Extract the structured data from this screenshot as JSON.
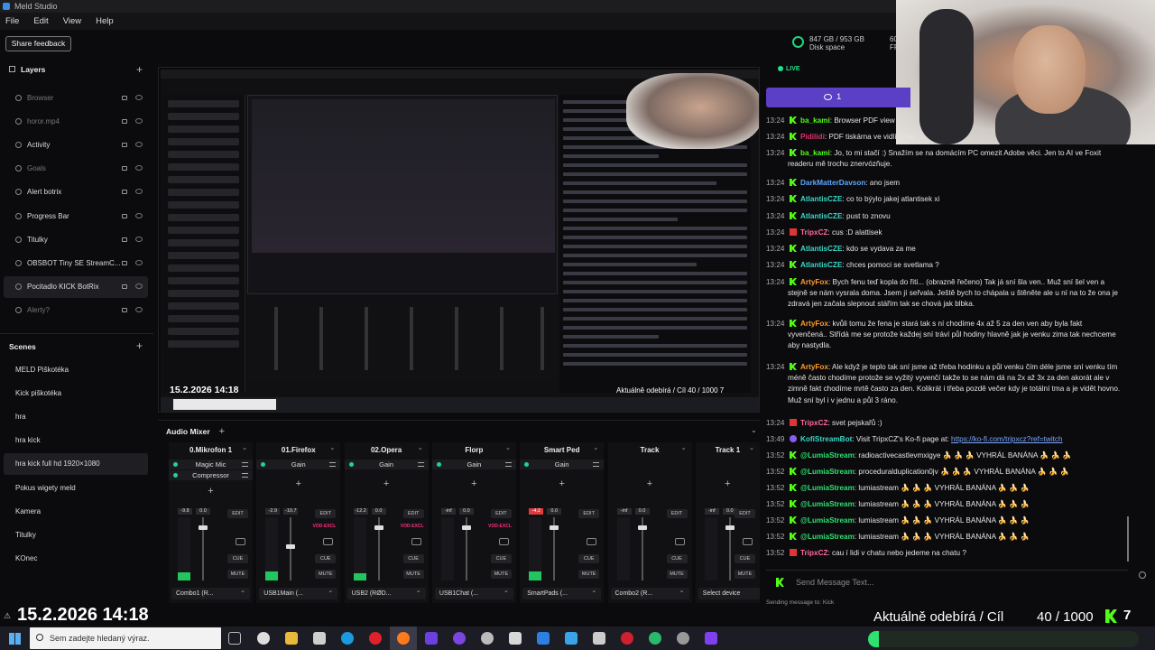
{
  "window": {
    "title": "Meld Studio"
  },
  "menu": [
    "File",
    "Edit",
    "View",
    "Help"
  ],
  "toolbar": {
    "share_feedback": "Share feedback"
  },
  "stats": {
    "disk_used": "847 GB / 953 GB",
    "disk_label": "Disk space",
    "fps_value": "60.",
    "fps_label": "FP"
  },
  "layers": {
    "title": "Layers",
    "items": [
      {
        "label": "Browser",
        "hidden": true
      },
      {
        "label": "horor.mp4",
        "hidden": true
      },
      {
        "label": "Activity",
        "hidden": false
      },
      {
        "label": "Goals",
        "hidden": true
      },
      {
        "label": "Alert botrix",
        "hidden": false
      },
      {
        "label": "Progress Bar",
        "hidden": false
      },
      {
        "label": "Titulky",
        "hidden": false
      },
      {
        "label": "OBSBOT Tiny SE StreamC...",
        "hidden": false
      },
      {
        "label": "Pocitadlo KICK BotRix",
        "hidden": false
      },
      {
        "label": "Alerty?",
        "hidden": true
      }
    ]
  },
  "scenes": {
    "title": "Scenes",
    "items": [
      "MELD Piškotéka",
      "Kick piškotéka",
      "hra",
      "hra kick",
      "hra kick full hd 1920×1080",
      "Pokus wigety meld",
      "Kamera",
      "Titulky",
      "KOnec"
    ]
  },
  "preview": {
    "date": "15.2.2026 14:18",
    "sub_goal": "Aktuálně odebírá / Cíl   40 / 1000  7"
  },
  "mixer": {
    "title": "Audio Mixer",
    "channels": [
      {
        "name": "0.Mikrofon 1",
        "effects": [
          "Magic Mic",
          "Compressor"
        ],
        "level": "-9.8",
        "gain": "0.0",
        "device": "Combo1 (R...",
        "vod": false,
        "clip": false
      },
      {
        "name": "01.Firefox",
        "effects": [
          "Gain"
        ],
        "level": "-2.9",
        "gain": "-10.7",
        "device": "USB1Main (...",
        "vod": true,
        "clip": false
      },
      {
        "name": "02.Opera",
        "effects": [
          "Gain"
        ],
        "level": "-12.2",
        "gain": "0.0",
        "device": "USB2 (RØD...",
        "vod": true,
        "clip": false
      },
      {
        "name": "Florp",
        "effects": [
          "Gain"
        ],
        "level": "-inf",
        "gain": "0.0",
        "device": "USB1Chat (...",
        "vod": true,
        "clip": false
      },
      {
        "name": "Smart Ped",
        "effects": [
          "Gain"
        ],
        "level": "-4.2",
        "gain": "0.0",
        "device": "SmartPads (...",
        "vod": false,
        "clip": true
      },
      {
        "name": "Track",
        "effects": [],
        "level": "-inf",
        "gain": "0.0",
        "device": "Combo2 (R...",
        "vod": false,
        "clip": false
      },
      {
        "name": "Track 1",
        "effects": [],
        "level": "-inf",
        "gain": "0.0",
        "device": "Select device",
        "vod": false,
        "clip": false
      }
    ],
    "buttons": {
      "edit": "EDIT",
      "cue": "CUE",
      "mute": "MUTE",
      "vod": "VOD-EXCL"
    }
  },
  "stream": {
    "live": "LIVE",
    "viewers": "1"
  },
  "chat": {
    "messages": [
      {
        "time": "13:24",
        "badge": "kick",
        "user": "ba_kami",
        "color": "#53fc18",
        "text": ": Browser PDF view"
      },
      {
        "time": "13:24",
        "badge": "kick",
        "user": "Pidilidi",
        "color": "#e0306a",
        "text": ": PDF tiskárna ve vidlích ne"
      },
      {
        "time": "13:24",
        "badge": "kick",
        "user": "ba_kami",
        "color": "#53fc18",
        "text": ": Jo, to mi stačí :) Snažím se na domácím PC omezit Adobe věci. Jen to AI ve Foxit readeru mě trochu znervózňuje."
      },
      {
        "time": "13:24",
        "badge": "kick",
        "user": "DarkMatterDavson",
        "color": "#5aa8ff",
        "text": ": ano jsem"
      },
      {
        "time": "13:24",
        "badge": "kick",
        "user": "AtlantisCZE",
        "color": "#3bd6c6",
        "text": ": co to býylo jakej atlantisek xi"
      },
      {
        "time": "13:24",
        "badge": "kick",
        "user": "AtlantisCZE",
        "color": "#3bd6c6",
        "text": ": pust to znovu"
      },
      {
        "time": "13:24",
        "badge": "sub",
        "user": "TripxCZ",
        "color": "#ff6b9a",
        "text": ": cus :D alattisek"
      },
      {
        "time": "13:24",
        "badge": "kick",
        "user": "AtlantisCZE",
        "color": "#3bd6c6",
        "text": ": kdo se vydava za me"
      },
      {
        "time": "13:24",
        "badge": "kick",
        "user": "AtlantisCZE",
        "color": "#3bd6c6",
        "text": ": chces pomoci se svetlama ?"
      },
      {
        "time": "13:24",
        "badge": "kick",
        "user": "ArtyFox",
        "color": "#ff9a2e",
        "text": ": Bych fenu teď kopla do řiti... (obrazně řečeno) Tak já sní šla ven.. Muž sní šel ven a stejně se nám vysrala doma. Jsem jí seřvala. Ještě bych to chápala u štěněte ale u ní na to že ona je zdravá jen začala slepnout stářím tak se chová jak blbka."
      },
      {
        "time": "13:24",
        "badge": "kick",
        "user": "ArtyFox",
        "color": "#ff9a2e",
        "text": ": kvůli tomu že fena je stará tak s ní chodíme 4x až 5 za den ven aby byla fakt vyvenčená.. Střídá me se protože každej sní tráví půl hodiny hlavně jak je venku zima tak nechceme aby nastydla."
      },
      {
        "time": "13:24",
        "badge": "kick",
        "user": "ArtyFox",
        "color": "#ff9a2e",
        "text": ": Ale když je teplo tak sní jsme až třeba hodinku a půl venku čím déle jsme sní venku tím méně často chodíme protože se vyžitý vyvenčí takže to se nám dá na 2x až 3x za den akorát ale v zimně fakt chodíme mrtě často za den. Kolikrát i třeba pozdě večer kdy je totální tma a je vidět hovno. Muž sní byl i v jednu a půl 3 ráno."
      },
      {
        "time": "13:24",
        "badge": "sub",
        "user": "TripxCZ",
        "color": "#ff6b9a",
        "text": ": svet pejskařů :)"
      },
      {
        "time": "13:49",
        "badge": "bot",
        "user": "KofiStreamBot",
        "color": "#3bd6c6",
        "text": ": Visit TripxCZ's Ko-fi page at: ",
        "link": "https://ko-fi.com/tripxcz?ref=twitch"
      },
      {
        "time": "13:52",
        "badge": "kick",
        "user": "@LumiaStream",
        "color": "#2ee06f",
        "text": ": radioactivecastlevmxigye 🍌 🍌 🍌 VYHRÁL BANÁNA 🍌 🍌 🍌"
      },
      {
        "time": "13:52",
        "badge": "kick",
        "user": "@LumiaStream",
        "color": "#2ee06f",
        "text": ": proceduralduplication0jv 🍌 🍌 🍌 VYHRÁL BANÁNA 🍌 🍌 🍌"
      },
      {
        "time": "13:52",
        "badge": "kick",
        "user": "@LumiaStream",
        "color": "#2ee06f",
        "text": ": lumiastream 🍌 🍌 🍌 VYHRÁL BANÁNA 🍌 🍌 🍌"
      },
      {
        "time": "13:52",
        "badge": "kick",
        "user": "@LumiaStream",
        "color": "#2ee06f",
        "text": ": lumiastream 🍌 🍌 🍌 VYHRÁL BANÁNA 🍌 🍌 🍌"
      },
      {
        "time": "13:52",
        "badge": "kick",
        "user": "@LumiaStream",
        "color": "#2ee06f",
        "text": ": lumiastream 🍌 🍌 🍌 VYHRÁL BANÁNA 🍌 🍌 🍌"
      },
      {
        "time": "13:52",
        "badge": "kick",
        "user": "@LumiaStream",
        "color": "#2ee06f",
        "text": ": lumiastream 🍌 🍌 🍌 VYHRÁL BANÁNA 🍌 🍌 🍌"
      },
      {
        "time": "13:52",
        "badge": "sub",
        "user": "TripxCZ",
        "color": "#ff6b9a",
        "text": ": cau í lidi v chatu nebo jedeme na chatu ?"
      }
    ],
    "input_placeholder": "Send Message Text...",
    "sending_to": "Sending message to: Kick"
  },
  "overlay": {
    "date": "15.2.2026 14:18",
    "subs_label": "Aktuálně odebírá / Cíl",
    "subs_count": "40 / 1000",
    "subs_value": "7",
    "progress": 0.04
  },
  "taskbar": {
    "search_placeholder": "Sem zadejte hledaný výraz."
  },
  "colors": {
    "accent": "#5b3fc5",
    "live": "#22e089",
    "kick": "#53fc18"
  }
}
